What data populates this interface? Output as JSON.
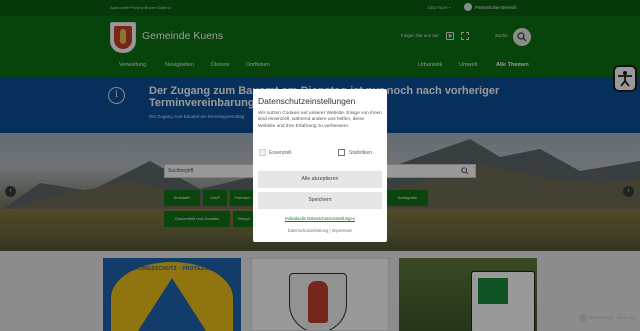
{
  "topbar": {
    "region": "Autonomie Provinz Bozen Südtirol",
    "language": "DEUTSCH",
    "language_caret": "⌄",
    "personal_area": "Persönlicher Bereich"
  },
  "header": {
    "site_title": "Gemeinde Kuens",
    "follow_label": "Folgen Sie uns auf",
    "search_label": "Suche",
    "rss_glyph": "◉"
  },
  "nav": {
    "left": [
      "Verwaltung",
      "Neuigkeiten",
      "Dienste",
      "Dorfleben"
    ],
    "right": [
      "Urbanistik",
      "Umwelt",
      "Alle Themen"
    ]
  },
  "notice": {
    "info_glyph": "i",
    "headline": "Der Zugang zum Bauamt am Dienstag ist nur noch nach vorheriger Terminvereinbarung m",
    "sub": "Der Zugang zum Bauamt am Dienstagvormittag"
  },
  "hero": {
    "search_placeholder": "Suchbegriff",
    "quick_links": [
      "Amtstafel",
      "GvbP",
      "Freiraum",
      "Gesundheit und Soziales",
      "Recycl",
      "Kartografie"
    ],
    "prev_glyph": "‹",
    "next_glyph": "›"
  },
  "cards": {
    "card1_text": "BEVÖLKERUNGSSCHUTZ · PROTEZIONE CIVILE"
  },
  "recaptcha": "Datenschutz · Nutzung",
  "cookie_modal": {
    "title": "Datenschutzeinstellungen",
    "text": "Wir nutzen Cookies auf unserer Website. Einige von ihnen sind essenziell, während andere uns helfen, diese Website und Ihre Erfahrung zu verbessern.",
    "essential_label": "Essenziell",
    "statistics_label": "Statistiken",
    "accept_all": "Alle akzeptieren",
    "save": "Speichern",
    "individual_link": "Individuelle Datenschutzeinstellungen",
    "footer_links": "Datenschutzerklärung | Impressum"
  },
  "colors": {
    "header_green": "#0c7214",
    "notice_blue": "#0b4f98",
    "button_grey": "#e6e6e6"
  }
}
